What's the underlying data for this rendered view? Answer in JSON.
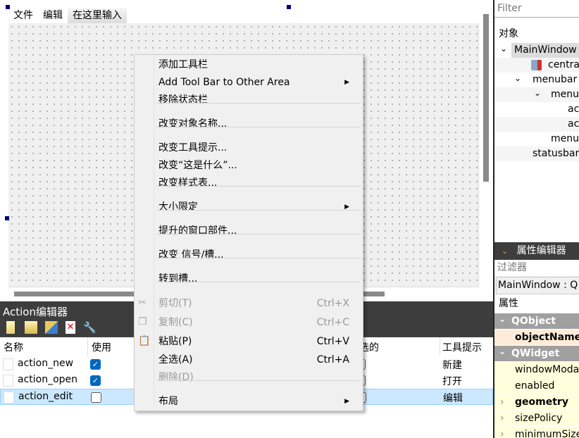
{
  "form": {
    "menubar": [
      "文件",
      "编辑",
      "在这里输入"
    ]
  },
  "action_editor": {
    "title": "Action编辑器",
    "toolbar": [
      "new-action-icon",
      "open-folder-icon",
      "copy-icon",
      "delete-icon",
      "wrench-icon"
    ],
    "columns": [
      "名称",
      "使用",
      "可选的",
      "工具提示"
    ],
    "rows": [
      {
        "name": "action_new",
        "used": true,
        "tooltip": "新建",
        "selected": false
      },
      {
        "name": "action_open",
        "used": true,
        "tooltip": "打开",
        "selected": false
      },
      {
        "name": "action_edit",
        "used": false,
        "tooltip": "编辑",
        "selected": true
      }
    ]
  },
  "object_inspector": {
    "filter_placeholder": "Filter",
    "column": "对象",
    "tree": [
      "MainWindow",
      "centra",
      "menubar",
      "menu",
      "act",
      "act",
      "menu_",
      "statusbar"
    ]
  },
  "property_editor": {
    "title": "属性编辑器",
    "filter_placeholder": "过滤器",
    "object": "MainWindow : Q",
    "column": "属性",
    "rows": [
      {
        "label": "QObject",
        "type": "group"
      },
      {
        "label": "objectName",
        "type": "bold"
      },
      {
        "label": "QWidget",
        "type": "group"
      },
      {
        "label": "windowModa",
        "type": "normal"
      },
      {
        "label": "enabled",
        "type": "normal"
      },
      {
        "label": "geometry",
        "type": "bold-expand"
      },
      {
        "label": "sizePolicy",
        "type": "expand"
      },
      {
        "label": "minimumSize",
        "type": "expand"
      }
    ]
  },
  "context_menu": {
    "items": [
      {
        "label": "添加工具栏"
      },
      {
        "label": "Add Tool Bar to Other Area",
        "submenu": true
      },
      {
        "label": "移除状态栏"
      },
      {
        "label": "改变对象名称..."
      },
      {
        "label": "改变工具提示..."
      },
      {
        "label": "改变“这是什么”..."
      },
      {
        "label": "改变样式表..."
      },
      {
        "label": "大小限定",
        "submenu": true
      },
      {
        "label": "提升的窗口部件..."
      },
      {
        "label": "改变 信号/槽..."
      },
      {
        "label": "转到槽..."
      },
      {
        "label": "剪切(T)",
        "shortcut": "Ctrl+X",
        "disabled": true,
        "icon": "scissors-icon"
      },
      {
        "label": "复制(C)",
        "shortcut": "Ctrl+C",
        "disabled": true,
        "icon": "copy-icon"
      },
      {
        "label": "粘贴(P)",
        "shortcut": "Ctrl+V",
        "icon": "paste-icon"
      },
      {
        "label": "全选(A)",
        "shortcut": "Ctrl+A"
      },
      {
        "label": "删除(D)",
        "disabled": true
      },
      {
        "label": "布局",
        "submenu": true
      }
    ]
  }
}
